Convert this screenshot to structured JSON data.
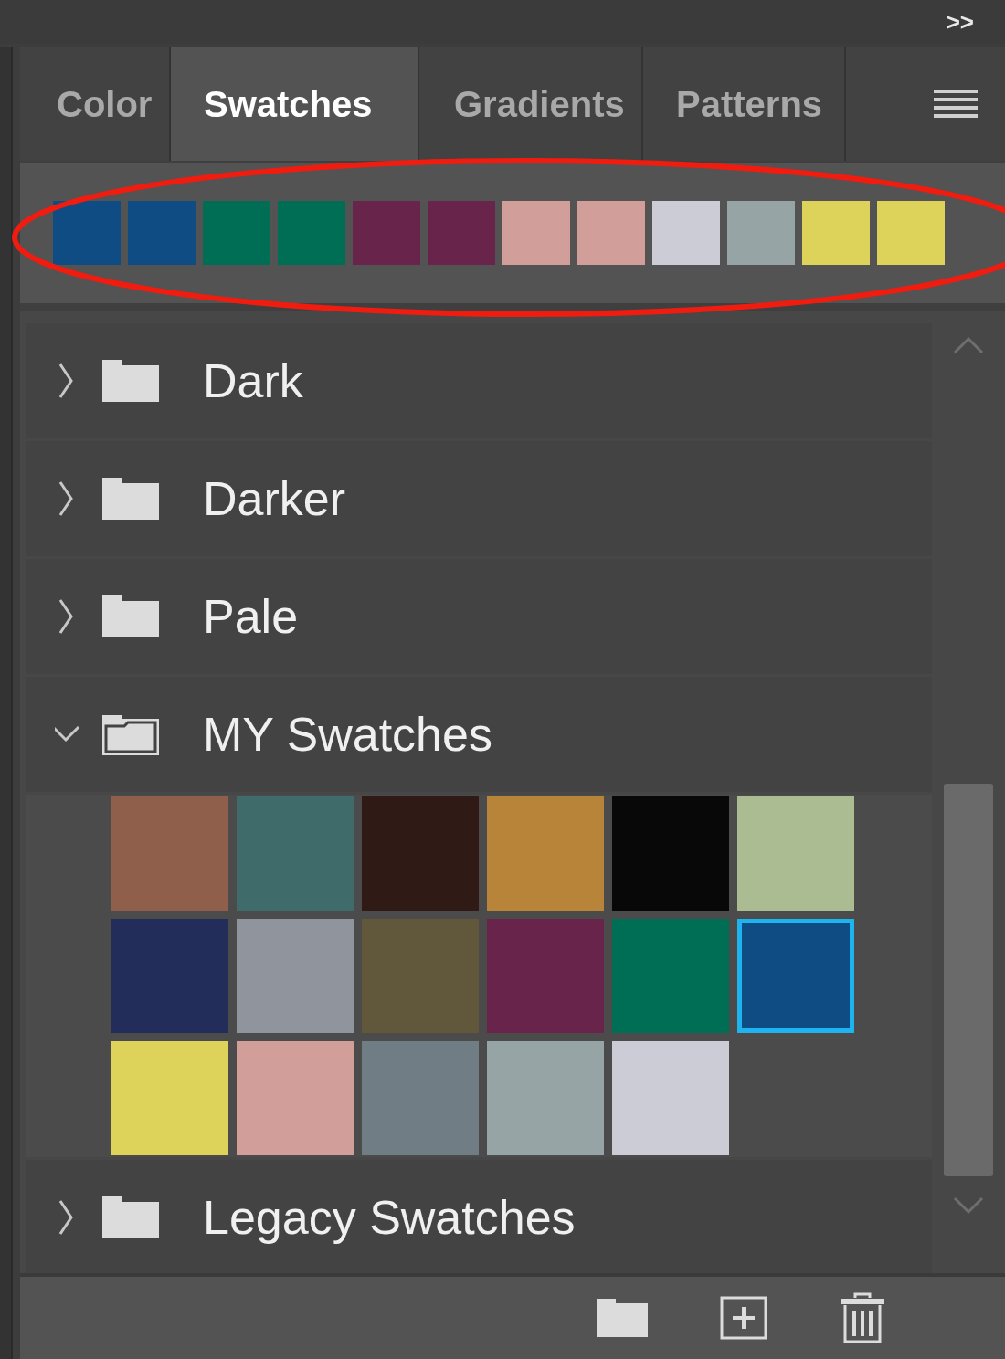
{
  "top_bar": {
    "collapse_label": ">>"
  },
  "tabs": [
    {
      "label": "Color",
      "selected": false
    },
    {
      "label": "Swatches",
      "selected": true
    },
    {
      "label": "Gradients",
      "selected": false
    },
    {
      "label": "Patterns",
      "selected": false
    }
  ],
  "recent_swatches": [
    {
      "color": "#0f4c84"
    },
    {
      "color": "#0f4c84"
    },
    {
      "color": "#006e54"
    },
    {
      "color": "#006e54"
    },
    {
      "color": "#68244b"
    },
    {
      "color": "#68244b"
    },
    {
      "color": "#d19e9a"
    },
    {
      "color": "#d19e9a"
    },
    {
      "color": "#cbccd6"
    },
    {
      "color": "#97a4a5"
    },
    {
      "color": "#ddd35a"
    },
    {
      "color": "#ddd35a"
    }
  ],
  "groups": [
    {
      "name": "Dark",
      "expanded": false
    },
    {
      "name": "Darker",
      "expanded": false
    },
    {
      "name": "Pale",
      "expanded": false
    },
    {
      "name": "MY Swatches",
      "expanded": true,
      "children": [
        {
          "color": "#8f5f4c",
          "selected": false
        },
        {
          "color": "#3f6b6a",
          "selected": false
        },
        {
          "color": "#2f1a16",
          "selected": false
        },
        {
          "color": "#b8843a",
          "selected": false
        },
        {
          "color": "#080808",
          "selected": false
        },
        {
          "color": "#abbb92",
          "selected": false
        },
        {
          "color": "#222d5a",
          "selected": false
        },
        {
          "color": "#90949c",
          "selected": false
        },
        {
          "color": "#61573a",
          "selected": false
        },
        {
          "color": "#68244b",
          "selected": false
        },
        {
          "color": "#006e54",
          "selected": false
        },
        {
          "color": "#0f4c84",
          "selected": true
        },
        {
          "color": "#ddd35a",
          "selected": false
        },
        {
          "color": "#d19e9a",
          "selected": false
        },
        {
          "color": "#717d85",
          "selected": false
        },
        {
          "color": "#97a4a5",
          "selected": false
        },
        {
          "color": "#cbccd6",
          "selected": false
        }
      ]
    },
    {
      "name": "Legacy Swatches",
      "expanded": false
    }
  ]
}
